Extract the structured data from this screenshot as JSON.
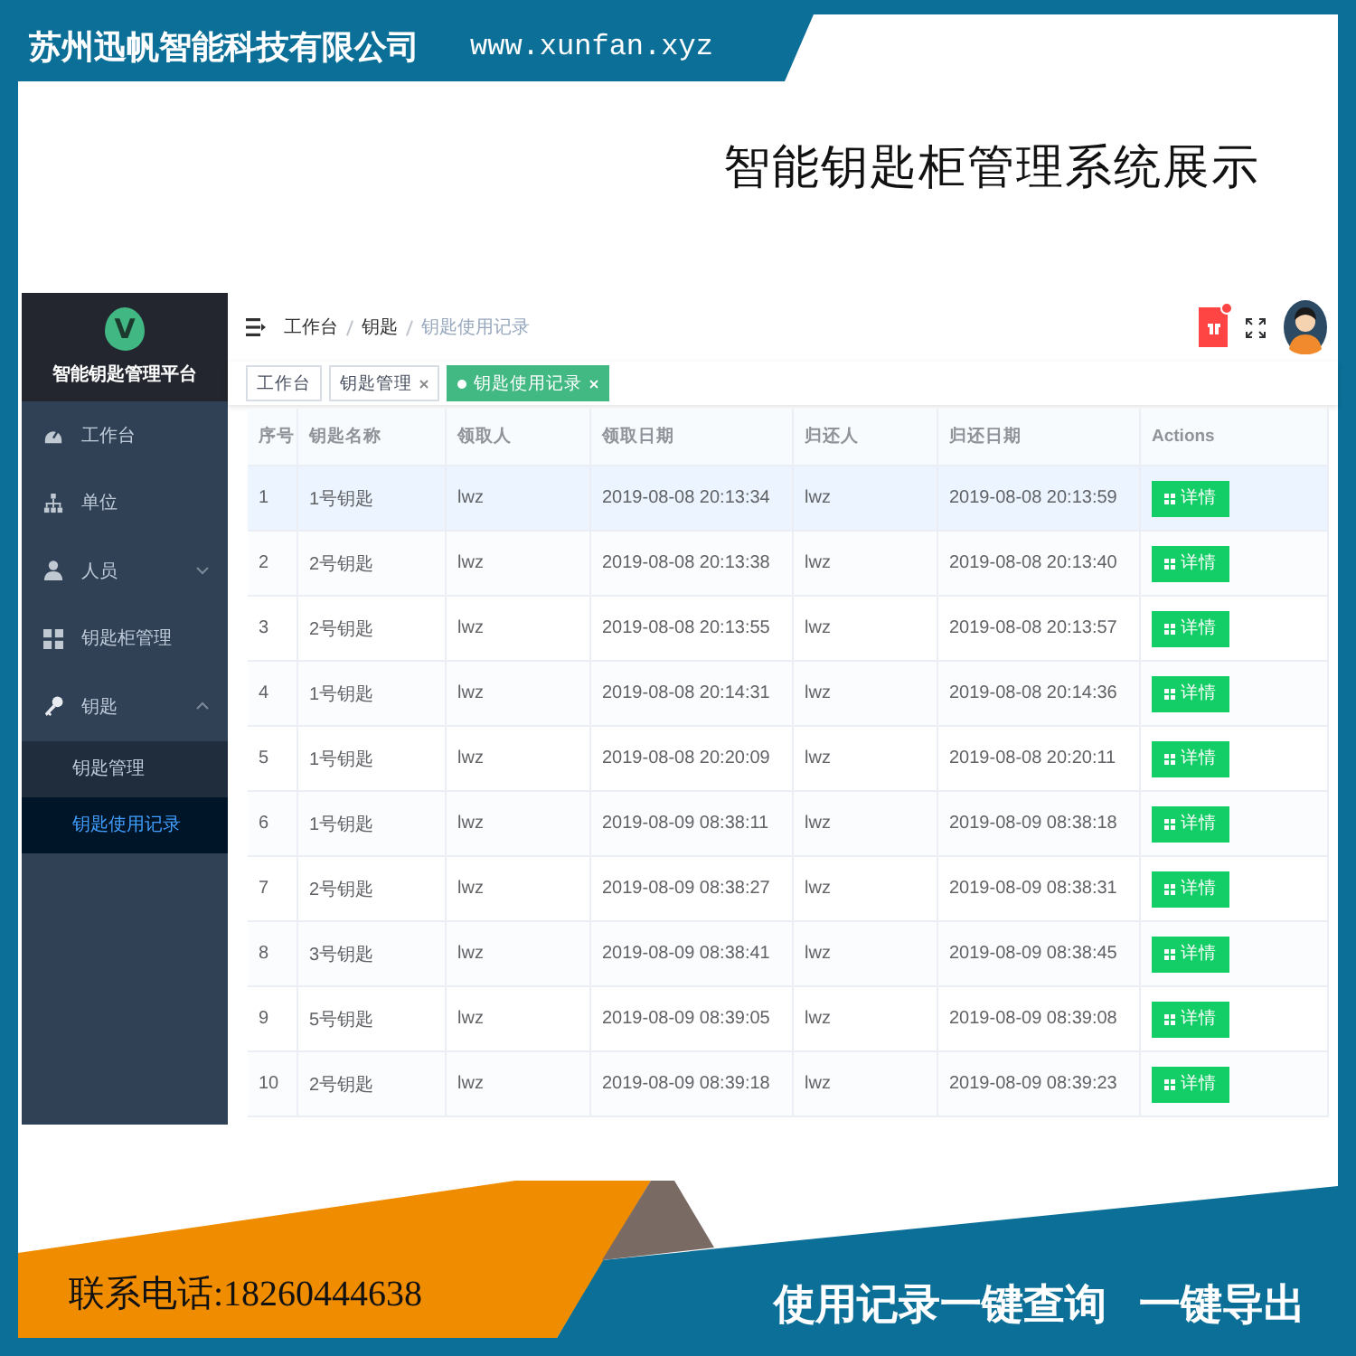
{
  "banner": {
    "company": "苏州迅帆智能科技有限公司",
    "website": "www.xunfan.xyz",
    "title": "智能钥匙柜管理系统展示"
  },
  "app": {
    "logo": "V",
    "platform": "智能钥匙管理平台",
    "sidebar": [
      {
        "label": "工作台"
      },
      {
        "label": "单位"
      },
      {
        "label": "人员",
        "expanded": false
      },
      {
        "label": "钥匙柜管理"
      },
      {
        "label": "钥匙",
        "expanded": true,
        "children": [
          {
            "label": "钥匙管理",
            "selected": false
          },
          {
            "label": "钥匙使用记录",
            "selected": true
          }
        ]
      }
    ],
    "breadcrumb": [
      {
        "label": "工作台",
        "current": false
      },
      {
        "label": "钥匙",
        "current": false
      },
      {
        "label": "钥匙使用记录",
        "current": true
      }
    ],
    "notification": true,
    "tabs": [
      {
        "label": "工作台",
        "selected": false,
        "closable": false
      },
      {
        "label": "钥匙管理",
        "selected": false,
        "closable": true
      },
      {
        "label": "钥匙使用记录",
        "selected": true,
        "closable": true
      }
    ],
    "table": {
      "columns": [
        "序号",
        "钥匙名称",
        "领取人",
        "领取日期",
        "归还人",
        "归还日期",
        "Actions"
      ],
      "rows": [
        {
          "highlighted": true,
          "cells": [
            "1",
            "1号钥匙",
            "lwz",
            "2019-08-08 20:13:34",
            "lwz",
            "2019-08-08 20:13:59"
          ],
          "action": "详情"
        },
        {
          "highlighted": false,
          "cells": [
            "2",
            "2号钥匙",
            "lwz",
            "2019-08-08 20:13:38",
            "lwz",
            "2019-08-08 20:13:40"
          ],
          "action": "详情"
        },
        {
          "highlighted": false,
          "cells": [
            "3",
            "2号钥匙",
            "lwz",
            "2019-08-08 20:13:55",
            "lwz",
            "2019-08-08 20:13:57"
          ],
          "action": "详情"
        },
        {
          "highlighted": false,
          "cells": [
            "4",
            "1号钥匙",
            "lwz",
            "2019-08-08 20:14:31",
            "lwz",
            "2019-08-08 20:14:36"
          ],
          "action": "详情"
        },
        {
          "highlighted": false,
          "cells": [
            "5",
            "1号钥匙",
            "lwz",
            "2019-08-08 20:20:09",
            "lwz",
            "2019-08-08 20:20:11"
          ],
          "action": "详情"
        },
        {
          "highlighted": false,
          "cells": [
            "6",
            "1号钥匙",
            "lwz",
            "2019-08-09 08:38:11",
            "lwz",
            "2019-08-09 08:38:18"
          ],
          "action": "详情"
        },
        {
          "highlighted": false,
          "cells": [
            "7",
            "2号钥匙",
            "lwz",
            "2019-08-09 08:38:27",
            "lwz",
            "2019-08-09 08:38:31"
          ],
          "action": "详情"
        },
        {
          "highlighted": false,
          "cells": [
            "8",
            "3号钥匙",
            "lwz",
            "2019-08-09 08:38:41",
            "lwz",
            "2019-08-09 08:38:45"
          ],
          "action": "详情"
        },
        {
          "highlighted": false,
          "cells": [
            "9",
            "5号钥匙",
            "lwz",
            "2019-08-09 08:39:05",
            "lwz",
            "2019-08-09 08:39:08"
          ],
          "action": "详情"
        },
        {
          "highlighted": false,
          "cells": [
            "10",
            "2号钥匙",
            "lwz",
            "2019-08-09 08:39:18",
            "lwz",
            "2019-08-09 08:39:23"
          ],
          "action": "详情"
        }
      ]
    }
  },
  "footer": {
    "phone": "联系电话:18260444638",
    "slogans": [
      "使用记录一键查询",
      "一键导出"
    ]
  }
}
